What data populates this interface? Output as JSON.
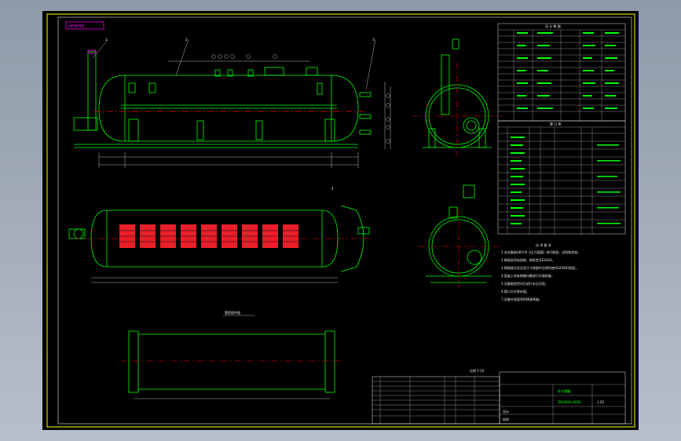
{
  "drawing": {
    "stamp": "材料表/N型",
    "view_top_caption": "管程部件图",
    "scale_note": "比例 1:10",
    "part_labels": [
      "1",
      "2",
      "3",
      "4",
      "5"
    ],
    "nozzle_labels": [
      "a",
      "b",
      "c",
      "d",
      "e",
      "f",
      "g",
      "h"
    ],
    "tables": {
      "design_data_title": "设 计 数 据",
      "nozzle_table_title": "管 口 表",
      "tech_req_title": "技 术 要 求",
      "tech_req_lines": [
        "1.本设备按GB150《压力容器》进行制造、试验和验收。",
        "2.焊接采用电弧焊，焊条型号E4303。",
        "3.焊接接头型式及尺寸除图中注明外按HG20583规定。",
        "4.容器上所有焊缝均需进行外观检查。",
        "5.设备制造完毕后进行水压试验。",
        "6.管口方位按本图。",
        "7.设备外表面涂防锈漆两遍。"
      ]
    },
    "title_block": {
      "name": "卧式储罐",
      "drawing_no": "DN1800×6000",
      "scale": "1:20",
      "designer": "设计",
      "checker": "校核"
    }
  },
  "colors": {
    "background": "#000000",
    "frame": "#ffff00",
    "geometry": "#00ff00",
    "dimension": "#e8e8e8",
    "centerline": "#ff0000",
    "accent": "#ff00ff"
  }
}
